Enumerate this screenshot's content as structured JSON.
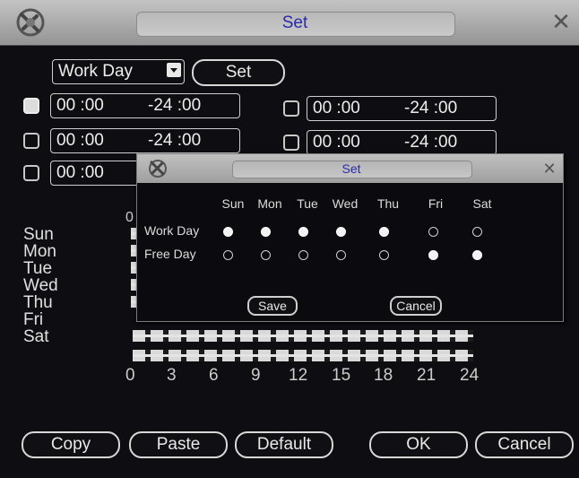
{
  "window": {
    "title": "Set"
  },
  "top": {
    "mode_select": "Work Day",
    "set_button": "Set"
  },
  "periods": [
    {
      "checked": true,
      "start": "00 :00",
      "end": "-24 :00"
    },
    {
      "checked": false,
      "start": "00 :00",
      "end": "-24 :00"
    },
    {
      "checked": false,
      "start": "00 :00",
      "end": "-24 :00"
    },
    {
      "checked": false,
      "start": "00 :00",
      "end": "-24 :00"
    },
    {
      "checked": false,
      "start": "00 :00",
      "end": ""
    }
  ],
  "timeline": {
    "days": [
      "Sun",
      "Mon",
      "Tue",
      "Wed",
      "Thu",
      "Fri",
      "Sat"
    ],
    "ticks": [
      "0",
      "3",
      "6",
      "9",
      "12",
      "15",
      "18",
      "21",
      "24"
    ],
    "top_tick": "0"
  },
  "bottom": {
    "copy": "Copy",
    "paste": "Paste",
    "default": "Default",
    "ok": "OK",
    "cancel": "Cancel"
  },
  "dialog": {
    "title": "Set",
    "days": [
      "Sun",
      "Mon",
      "Tue",
      "Wed",
      "Thu",
      "Fri",
      "Sat"
    ],
    "rows": [
      {
        "label": "Work Day",
        "selected": [
          true,
          true,
          true,
          true,
          true,
          false,
          false
        ]
      },
      {
        "label": "Free Day",
        "selected": [
          false,
          false,
          false,
          false,
          false,
          true,
          true
        ]
      }
    ],
    "save": "Save",
    "cancel": "Cancel"
  },
  "colors": {
    "title_text": "#2a2aa8",
    "background": "#0e0e12",
    "titlebar": "#b0b0b0"
  }
}
